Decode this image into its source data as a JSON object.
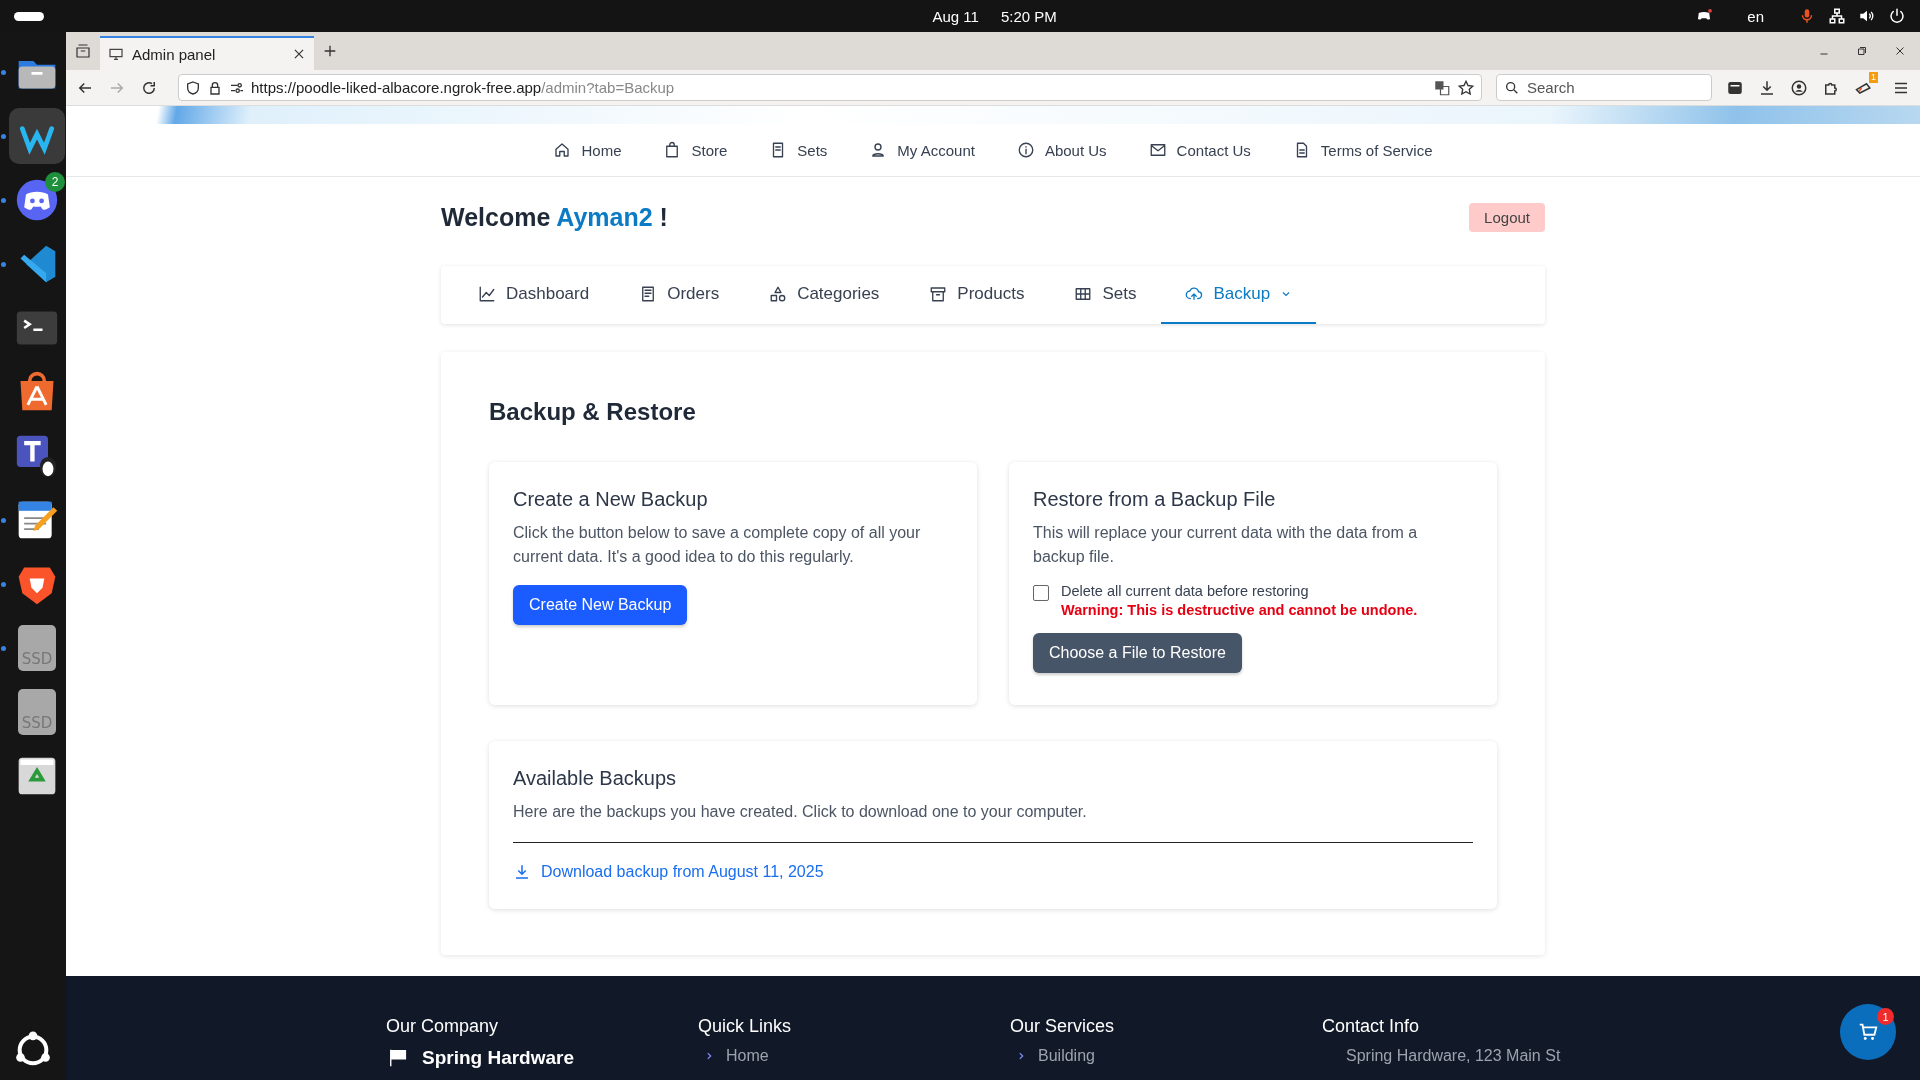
{
  "top_bar": {
    "date": "Aug 11",
    "time": "5:20 PM",
    "language": "en"
  },
  "dock": {
    "items": [
      {
        "kind": "folder",
        "running": true
      },
      {
        "kind": "wave",
        "running": true
      },
      {
        "kind": "chat",
        "running": true,
        "badge": "2"
      },
      {
        "kind": "code",
        "running": true
      },
      {
        "kind": "terminal",
        "running": false
      },
      {
        "kind": "bag",
        "running": false
      },
      {
        "kind": "penguin",
        "running": false
      },
      {
        "kind": "notepad",
        "running": true
      },
      {
        "kind": "lion",
        "running": true
      },
      {
        "kind": "drive",
        "running": true,
        "label": "SSD"
      },
      {
        "kind": "drive",
        "running": false,
        "label": "SSD"
      },
      {
        "kind": "trash",
        "running": false
      }
    ]
  },
  "browser": {
    "tab_title": "Admin panel",
    "url_host": "https://poodle-liked-albacore.ngrok-free.app",
    "url_path": "/admin?tab=Backup",
    "search_placeholder": "Search",
    "extension_badge": "1"
  },
  "site_nav": {
    "items": [
      {
        "kind": "home",
        "label": "Home"
      },
      {
        "kind": "bag",
        "label": "Store"
      },
      {
        "kind": "book",
        "label": "Sets"
      },
      {
        "kind": "user",
        "label": "My Account"
      },
      {
        "kind": "info",
        "label": "About Us"
      },
      {
        "kind": "mail",
        "label": "Contact Us"
      },
      {
        "kind": "doc",
        "label": "Terms of Service"
      }
    ]
  },
  "welcome": {
    "greeting": "Welcome",
    "user": "Ayman2",
    "suffix": "!",
    "logout": "Logout"
  },
  "admin_tabs": [
    {
      "kind": "chart",
      "label": "Dashboard",
      "selected": false
    },
    {
      "kind": "receipt",
      "label": "Orders",
      "selected": false
    },
    {
      "kind": "shapes",
      "label": "Categories",
      "selected": false
    },
    {
      "kind": "archive",
      "label": "Products",
      "selected": false
    },
    {
      "kind": "grid",
      "label": "Sets",
      "selected": false
    },
    {
      "kind": "cloud",
      "label": "Backup",
      "selected": true,
      "dropdown": true
    }
  ],
  "backup": {
    "title": "Backup & Restore",
    "create": {
      "title": "Create a New Backup",
      "text": "Click the button below to save a complete copy of all your current data. It's a good idea to do this regularly.",
      "button": "Create New Backup"
    },
    "restore": {
      "title": "Restore from a Backup File",
      "text": "This will replace your current data with the data from a backup file.",
      "checkbox_label": "Delete all current data before restoring",
      "checked": false,
      "warning": "Warning: This is destructive and cannot be undone.",
      "button": "Choose a File to Restore"
    },
    "available": {
      "title": "Available Backups",
      "text": "Here are the backups you have created. Click to download one to your computer.",
      "downloads": [
        "Download backup from August 11, 2025"
      ]
    }
  },
  "footer": {
    "columns": [
      {
        "title": "Our Company",
        "items": [
          "Spring Hardware"
        ],
        "kind": "brand"
      },
      {
        "title": "Quick Links",
        "items": [
          "Home"
        ],
        "kind": "links"
      },
      {
        "title": "Our Services",
        "items": [
          "Building"
        ],
        "kind": "links"
      },
      {
        "title": "Contact Info",
        "items": [
          "Spring Hardware, 123 Main St"
        ],
        "kind": "contact"
      }
    ],
    "cart_badge": "1"
  }
}
